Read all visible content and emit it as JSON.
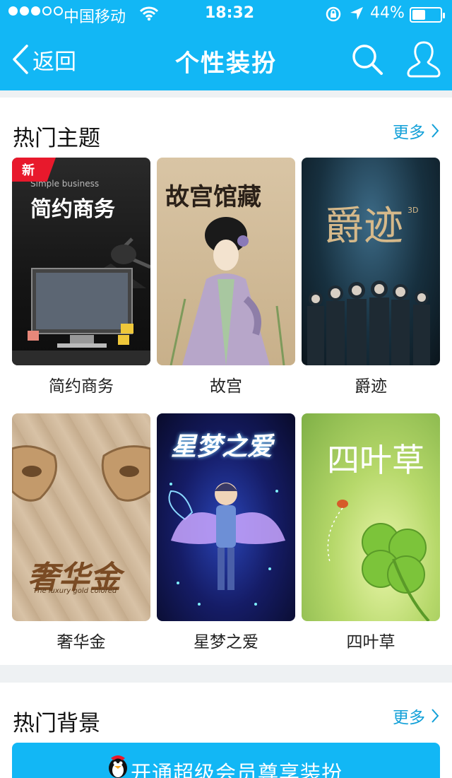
{
  "status_bar": {
    "carrier": "中国移动",
    "time": "18:32",
    "battery_percent": "44%",
    "battery_level": 0.44,
    "signal_bars": 3,
    "signal_total": 5
  },
  "nav": {
    "back_label": "返回",
    "title": "个性装扮",
    "icons": [
      "back-chevron-icon",
      "search-icon",
      "user-profile-icon"
    ]
  },
  "hot_themes": {
    "title": "热门主题",
    "more_label": "更多",
    "items": [
      {
        "label": "简约商务",
        "badge": "新",
        "thumb_en": "Simple business",
        "thumb_cn": "简约商务"
      },
      {
        "label": "故宫",
        "thumb_cn": "故宫馆藏"
      },
      {
        "label": "爵迹",
        "thumb_cn": "爵迹",
        "thumb_sup": "3D"
      },
      {
        "label": "奢华金",
        "thumb_cn": "奢华金",
        "thumb_en": "The luxury gold colored"
      },
      {
        "label": "星梦之爱",
        "thumb_cn": "星梦之爱"
      },
      {
        "label": "四叶草",
        "thumb_cn": "四叶草"
      }
    ]
  },
  "hot_backgrounds": {
    "title": "热门背景",
    "more_label": "更多"
  },
  "vip_button": {
    "label": "开通超级会员尊享装扮"
  },
  "colors": {
    "accent": "#12b7f5",
    "link": "#12a0d8",
    "badge_red": "#e8192c",
    "page_bg": "#eef1f3"
  }
}
